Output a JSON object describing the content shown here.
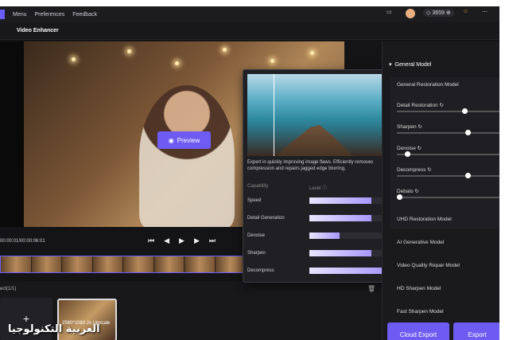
{
  "topbar": {
    "menu": "Menu",
    "preferences": "Preferences",
    "feedback": "Feedback",
    "credits": "3659"
  },
  "toolbar": {
    "title": "Video Enhancer"
  },
  "player": {
    "preview_label": "Preview",
    "time": "00:00:01/00:00:06:01"
  },
  "project": {
    "label": "ect(1/1)",
    "thumb_label": "2560*1080 2x Upscale"
  },
  "watermark": "العربية التكنولوجيا",
  "popup": {
    "description": "Expert in quickly improving image flaws. Efficiently removes compression and repairs jagged edge blurring.",
    "capability_header": "Capability",
    "level_header": "Level",
    "rows": [
      {
        "label": "Speed",
        "level": 0.82
      },
      {
        "label": "Detail Generation",
        "level": 0.82
      },
      {
        "label": "Denoise",
        "level": 0.4
      },
      {
        "label": "Sharpen",
        "level": 0.82
      },
      {
        "label": "Decompress",
        "level": 1.0
      }
    ]
  },
  "right_panel": {
    "general_model": "General Model",
    "restoration_model": "General Restoration Model",
    "sliders": [
      {
        "label": "Detail Restoration",
        "value": 0.68
      },
      {
        "label": "Sharpen",
        "value": 0.72
      },
      {
        "label": "Denoise",
        "value": 0.08
      },
      {
        "label": "Decompress",
        "value": 0.72
      },
      {
        "label": "Debalo",
        "value": 0.0
      }
    ],
    "models": [
      "UHD Restoration Model",
      "AI Generative Model",
      "Video Quality Repair Model",
      "HD Sharpen Model",
      "Fast Sharpen Model"
    ]
  },
  "buttons": {
    "cloud_export": "Cloud Export",
    "export": "Export"
  }
}
